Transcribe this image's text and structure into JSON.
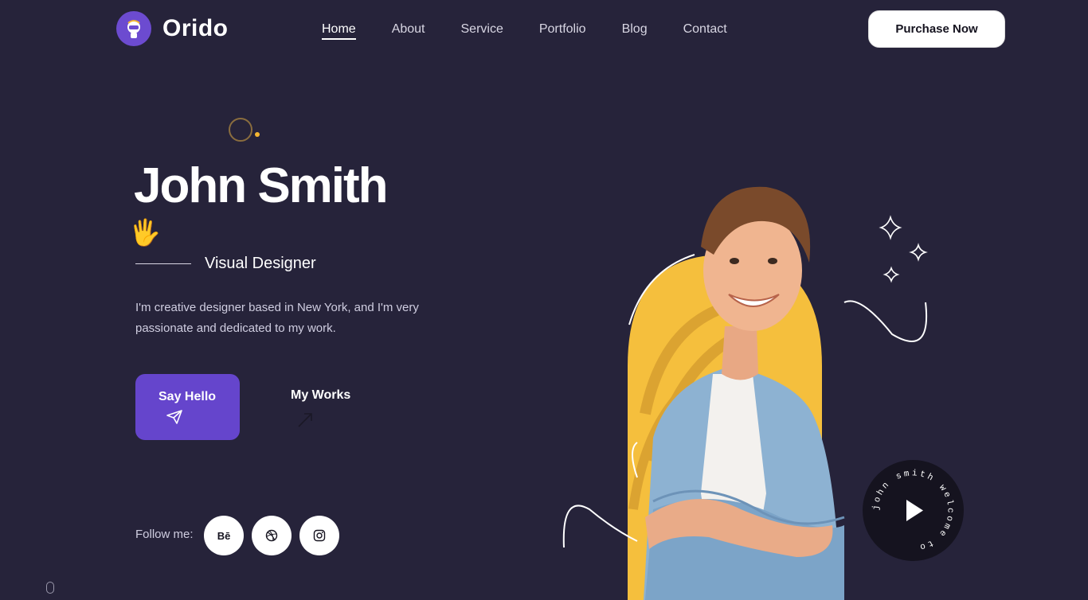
{
  "brand": {
    "name": "Orido"
  },
  "nav": {
    "items": [
      {
        "label": "Home",
        "active": true
      },
      {
        "label": "About",
        "active": false
      },
      {
        "label": "Service",
        "active": false
      },
      {
        "label": "Portfolio",
        "active": false
      },
      {
        "label": "Blog",
        "active": false
      },
      {
        "label": "Contact",
        "active": false
      }
    ],
    "cta_label": "Purchase Now"
  },
  "hero": {
    "name": "John Smith",
    "wave_emoji": "🖐",
    "role": "Visual Designer",
    "bio": "I'm creative designer based in New York, and I'm very passionate and dedicated to my work.",
    "primary_button": "Say Hello",
    "secondary_button": "My Works"
  },
  "social": {
    "label": "Follow me:",
    "items": [
      {
        "name": "behance",
        "text": "Bē"
      },
      {
        "name": "dribbble",
        "text": ""
      },
      {
        "name": "instagram",
        "text": ""
      }
    ]
  },
  "video": {
    "ring_text": "john smith welcome to"
  },
  "colors": {
    "background": "#26233a",
    "accent": "#6545cc",
    "yellow": "#f5b731",
    "white": "#ffffff"
  }
}
